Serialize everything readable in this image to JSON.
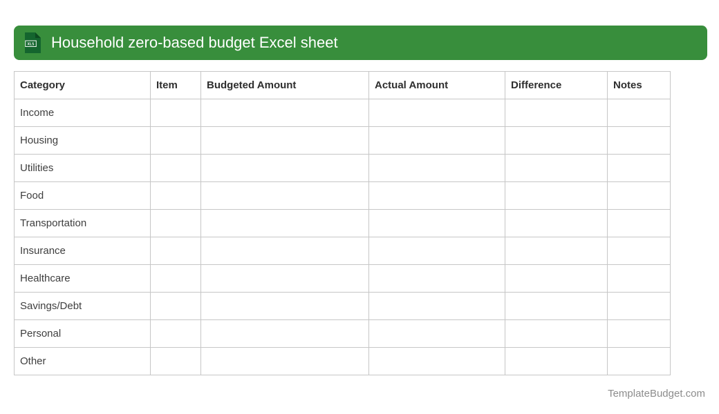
{
  "banner": {
    "title": "Household zero-based budget Excel sheet",
    "icon_label": "XLS"
  },
  "colors": {
    "banner_green": "#388e3c",
    "icon_dark_green": "#14652e",
    "icon_fold_green": "#0c4a20",
    "table_border": "#c6c6c6",
    "header_text": "#2e2e2e",
    "body_text": "#3e3e3e",
    "footer_text": "#8c8c8c"
  },
  "table": {
    "columns": [
      "Category",
      "Item",
      "Budgeted Amount",
      "Actual Amount",
      "Difference",
      "Notes"
    ],
    "rows": [
      [
        "Income",
        "",
        "",
        "",
        "",
        ""
      ],
      [
        "Housing",
        "",
        "",
        "",
        "",
        ""
      ],
      [
        "Utilities",
        "",
        "",
        "",
        "",
        ""
      ],
      [
        "Food",
        "",
        "",
        "",
        "",
        ""
      ],
      [
        "Transportation",
        "",
        "",
        "",
        "",
        ""
      ],
      [
        "Insurance",
        "",
        "",
        "",
        "",
        ""
      ],
      [
        "Healthcare",
        "",
        "",
        "",
        "",
        ""
      ],
      [
        "Savings/Debt",
        "",
        "",
        "",
        "",
        ""
      ],
      [
        "Personal",
        "",
        "",
        "",
        "",
        ""
      ],
      [
        "Other",
        "",
        "",
        "",
        "",
        ""
      ]
    ]
  },
  "footer": {
    "credit": "TemplateBudget.com"
  }
}
